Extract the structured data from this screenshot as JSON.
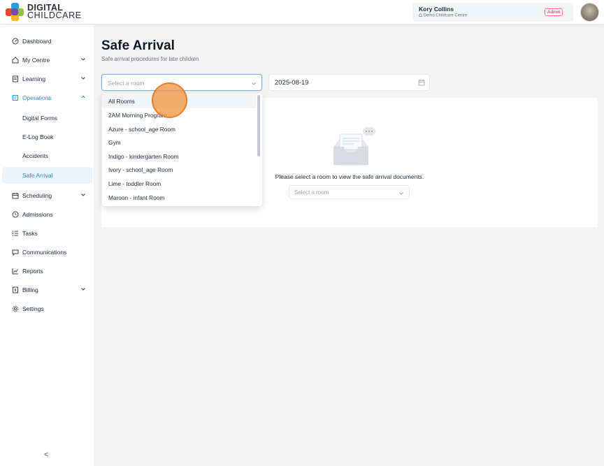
{
  "header": {
    "logo_line1": "DIGITAL",
    "logo_line2": "CHILDCARE",
    "user_name": "Kory Collins",
    "centre_name": "Demo Childcare Centre",
    "role_badge": "Admin"
  },
  "sidebar": {
    "items": [
      {
        "label": "Dashboard",
        "icon": "dashboard-icon"
      },
      {
        "label": "My Centre",
        "icon": "home-icon"
      },
      {
        "label": "Learning",
        "icon": "book-icon"
      },
      {
        "label": "Operations",
        "icon": "clipboard-icon"
      },
      {
        "label": "Digital Forms"
      },
      {
        "label": "E-Log Book"
      },
      {
        "label": "Accidents"
      },
      {
        "label": "Safe Arrival"
      },
      {
        "label": "Scheduling",
        "icon": "calendar-icon"
      },
      {
        "label": "Admissions",
        "icon": "clock-icon"
      },
      {
        "label": "Tasks",
        "icon": "list-icon"
      },
      {
        "label": "Communications",
        "icon": "chat-icon"
      },
      {
        "label": "Reports",
        "icon": "chart-icon"
      },
      {
        "label": "Billing",
        "icon": "invoice-icon"
      },
      {
        "label": "Settings",
        "icon": "gear-icon"
      }
    ],
    "collapse_glyph": "<"
  },
  "main": {
    "title": "Safe Arrival",
    "subtitle": "Safe arrival procedures for late children",
    "room_select_placeholder": "Select a room",
    "date_value": "2025-08-19",
    "empty_message": "Please select a room to view the safe arrival documents.",
    "inner_select_placeholder": "Select a room"
  },
  "dropdown": {
    "options": [
      "All Rooms",
      "2AM Morning Program",
      "Azure - school_age Room",
      "Gym",
      "Indigo - kindergarten Room",
      "Ivory - school_age Room",
      "Lime - toddler Room",
      "Maroon - infant Room"
    ]
  },
  "colors": {
    "accent": "#2b8fd1",
    "badge": "#c8102e",
    "click_marker": "#f0964a"
  }
}
